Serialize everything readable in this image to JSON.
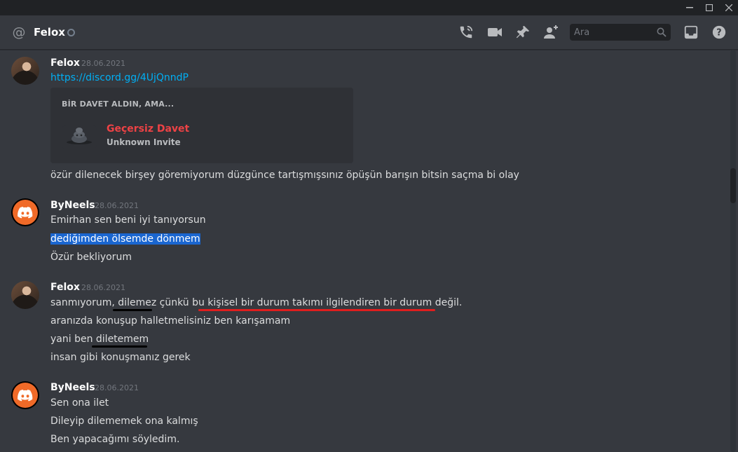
{
  "window": {
    "minimize": "—",
    "maximize": "☐",
    "close": "✕"
  },
  "header": {
    "channel_name": "Felox",
    "search_placeholder": "Ara",
    "icons": [
      "at-icon",
      "call-icon",
      "video-icon",
      "pin-icon",
      "add-friend-icon",
      "search-icon",
      "inbox-icon",
      "help-icon"
    ]
  },
  "messages": [
    {
      "author": "Felox",
      "timestamp": "28.06.2021",
      "lines": [
        "https://discord.gg/4UjQnndP",
        "özür dilenecek birşey göremiyorum düzgünce tartışmışsınız öpüşün barışın bitsin saçma bi olay"
      ],
      "embed": {
        "title": "BİR DAVET ALDIN, AMA...",
        "name": "Geçersiz Davet",
        "subtitle": "Unknown Invite"
      }
    },
    {
      "author": "ByNeels",
      "timestamp": "28.06.2021",
      "lines": [
        "Emirhan sen beni iyi tanıyorsun",
        "dediğimden ölsemde dönmem",
        "Özür bekliyorum"
      ]
    },
    {
      "author": "Felox",
      "timestamp": "28.06.2021",
      "lines": [
        "sanmıyorum, dilemez çünkü bu kişisel bir durum takımı ilgilendiren bir durum değil.",
        "aranızda konuşup halletmelisiniz ben karışamam",
        "yani ben diletemem",
        "insan gibi konuşmanız gerek"
      ]
    },
    {
      "author": "ByNeels",
      "timestamp": "28.06.2021",
      "lines": [
        "Sen ona ilet",
        "Dileyip dilememek ona kalmış",
        "Ben yapacağımı söyledim."
      ]
    }
  ],
  "colors": {
    "background": "#36393f",
    "link": "#00aff4",
    "selection": "#1a66d0",
    "invalid_invite": "#ed4245",
    "annotation_black": "#000000",
    "annotation_red": "#e01e1e"
  }
}
